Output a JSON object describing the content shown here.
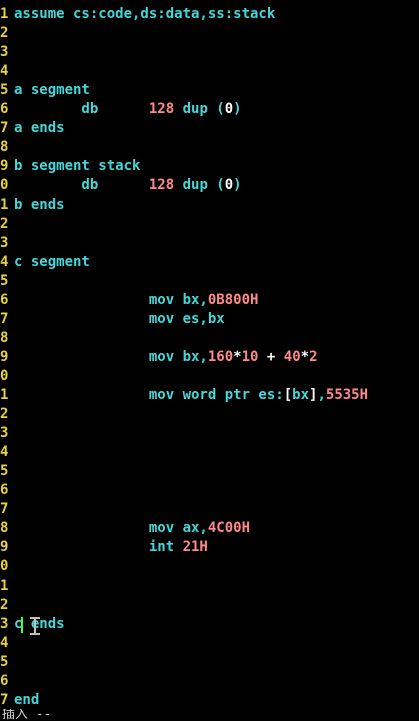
{
  "editor": {
    "lines": [
      {
        "n": "1",
        "tokens": [
          {
            "t": "assume cs:code,ds:data,ss:stack",
            "c": "kw"
          }
        ]
      },
      {
        "n": "2",
        "tokens": []
      },
      {
        "n": "3",
        "tokens": []
      },
      {
        "n": "4",
        "tokens": []
      },
      {
        "n": "5",
        "tokens": [
          {
            "t": "a segment",
            "c": "kw"
          }
        ]
      },
      {
        "n": "6",
        "tokens": [
          {
            "t": "        db      ",
            "c": "kw"
          },
          {
            "t": "128",
            "c": "num"
          },
          {
            "t": " dup (",
            "c": "kw"
          },
          {
            "t": "0",
            "c": "op"
          },
          {
            "t": ")",
            "c": "kw"
          }
        ]
      },
      {
        "n": "7",
        "tokens": [
          {
            "t": "a ends",
            "c": "kw"
          }
        ]
      },
      {
        "n": "8",
        "tokens": []
      },
      {
        "n": "9",
        "tokens": [
          {
            "t": "b segment stack",
            "c": "kw"
          }
        ]
      },
      {
        "n": "0",
        "tokens": [
          {
            "t": "        db      ",
            "c": "kw"
          },
          {
            "t": "128",
            "c": "num"
          },
          {
            "t": " dup (",
            "c": "kw"
          },
          {
            "t": "0",
            "c": "op"
          },
          {
            "t": ")",
            "c": "kw"
          }
        ]
      },
      {
        "n": "1",
        "tokens": [
          {
            "t": "b ends",
            "c": "kw"
          }
        ]
      },
      {
        "n": "2",
        "tokens": []
      },
      {
        "n": "3",
        "tokens": []
      },
      {
        "n": "4",
        "tokens": [
          {
            "t": "c segment",
            "c": "kw"
          }
        ]
      },
      {
        "n": "5",
        "tokens": []
      },
      {
        "n": "6",
        "tokens": [
          {
            "t": "                mov bx,",
            "c": "kw"
          },
          {
            "t": "0B800H",
            "c": "num"
          }
        ]
      },
      {
        "n": "7",
        "tokens": [
          {
            "t": "                mov es,bx",
            "c": "kw"
          }
        ]
      },
      {
        "n": "8",
        "tokens": []
      },
      {
        "n": "9",
        "tokens": [
          {
            "t": "                mov bx,",
            "c": "kw"
          },
          {
            "t": "160",
            "c": "num"
          },
          {
            "t": "*",
            "c": "op"
          },
          {
            "t": "10",
            "c": "num"
          },
          {
            "t": " + ",
            "c": "op"
          },
          {
            "t": "40",
            "c": "num"
          },
          {
            "t": "*",
            "c": "op"
          },
          {
            "t": "2",
            "c": "num"
          }
        ]
      },
      {
        "n": "0",
        "tokens": []
      },
      {
        "n": "1",
        "tokens": [
          {
            "t": "                mov word ptr es:",
            "c": "kw"
          },
          {
            "t": "[",
            "c": "op"
          },
          {
            "t": "bx",
            "c": "kw"
          },
          {
            "t": "]",
            "c": "op"
          },
          {
            "t": ",",
            "c": "kw"
          },
          {
            "t": "5535H",
            "c": "num"
          }
        ]
      },
      {
        "n": "2",
        "tokens": []
      },
      {
        "n": "3",
        "tokens": []
      },
      {
        "n": "4",
        "tokens": []
      },
      {
        "n": "5",
        "tokens": []
      },
      {
        "n": "6",
        "tokens": []
      },
      {
        "n": "7",
        "tokens": []
      },
      {
        "n": "8",
        "tokens": [
          {
            "t": "                mov ax,",
            "c": "kw"
          },
          {
            "t": "4C00H",
            "c": "num"
          }
        ]
      },
      {
        "n": "9",
        "tokens": [
          {
            "t": "                int ",
            "c": "kw"
          },
          {
            "t": "21H",
            "c": "num"
          }
        ]
      },
      {
        "n": "0",
        "tokens": []
      },
      {
        "n": "1",
        "tokens": []
      },
      {
        "n": "2",
        "tokens": []
      },
      {
        "n": "3",
        "tokens": [
          {
            "t": "c ends",
            "c": "kw"
          }
        ]
      },
      {
        "n": "4",
        "tokens": []
      },
      {
        "n": "5",
        "tokens": []
      },
      {
        "n": "6",
        "tokens": []
      },
      {
        "n": "7",
        "tokens": [
          {
            "t": "end",
            "c": "kw"
          }
        ]
      }
    ]
  },
  "status": {
    "text": "插入 --"
  },
  "colors": {
    "background": "#000000",
    "line_number": "#e6d23a",
    "keyword": "#44d7d9",
    "number": "#ff8a8a",
    "operator": "#ffffff",
    "cursor": "#3cff52"
  }
}
